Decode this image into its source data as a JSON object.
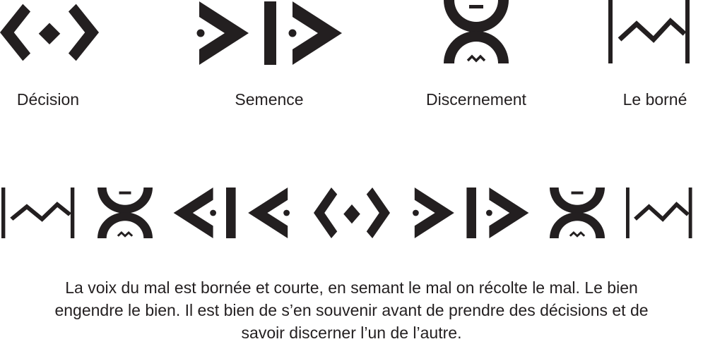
{
  "colors": {
    "ink": "#231f20",
    "background": "#ffffff"
  },
  "legend": [
    {
      "icon": "decision-icon",
      "label": "Décision"
    },
    {
      "icon": "semence-icon",
      "label": "Semence"
    },
    {
      "icon": "discernement-icon",
      "label": "Discernement"
    },
    {
      "icon": "le-borne-icon",
      "label": "Le borné"
    }
  ],
  "sequence": [
    "le-borne-icon",
    "discernement-icon",
    "semence-icon-mirrored",
    "decision-icon",
    "semence-icon",
    "discernement-icon",
    "le-borne-icon"
  ],
  "caption": {
    "line1": "La voix du mal est bornée et courte, en semant le mal on récolte le mal. Le bien",
    "line2": "engendre le bien. Il est bien de s’en souvenir avant de prendre des décisions et de",
    "line3": "savoir discerner l’un de l’autre."
  }
}
